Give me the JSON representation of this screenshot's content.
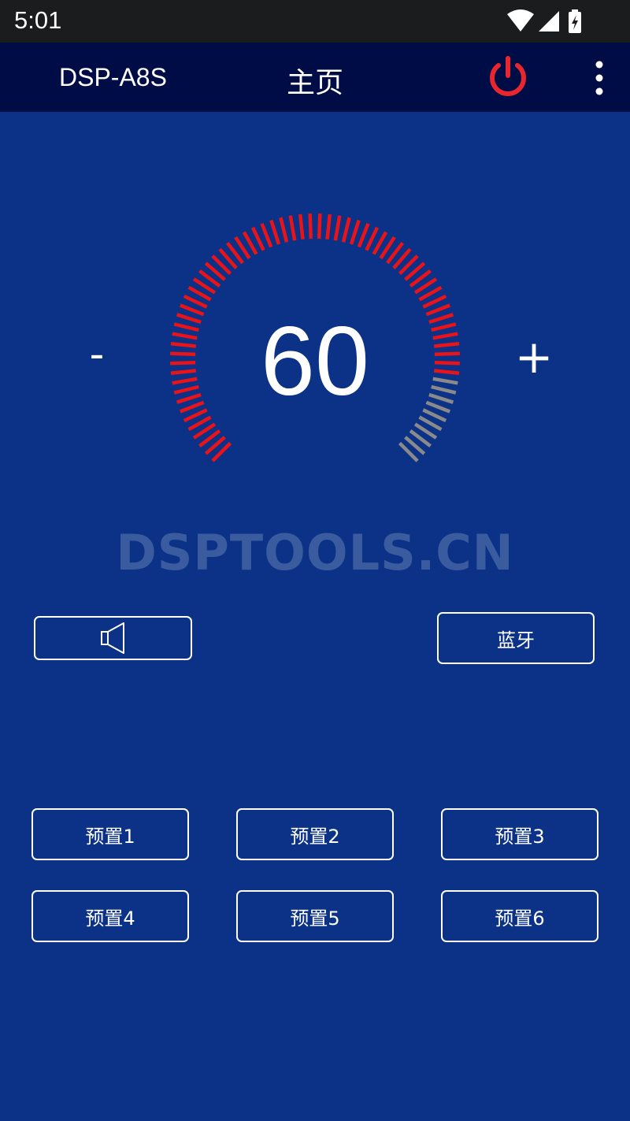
{
  "status_bar": {
    "time": "5:01",
    "icons": [
      "wifi-icon",
      "cell-signal-icon",
      "battery-charging-icon"
    ]
  },
  "header": {
    "device_name": "DSP-A8S",
    "title": "主页",
    "power_icon": "power-icon",
    "menu_icon": "more-vert-icon",
    "power_color": "#e8262d"
  },
  "volume": {
    "value": "60",
    "level": 60,
    "max": 70,
    "minus_label": "-",
    "plus_label": "+",
    "active_color": "#ea1318",
    "inactive_color": "#8a8a8a"
  },
  "watermark": "DSPTOOLS.CN",
  "controls": {
    "mute_icon": "speaker-icon",
    "bluetooth_label": "蓝牙"
  },
  "presets": [
    "预置1",
    "预置2",
    "预置3",
    "预置4",
    "预置5",
    "预置6"
  ],
  "colors": {
    "background": "#0b3287",
    "app_bar": "#000c46",
    "status_bar": "#1b1c1e"
  }
}
